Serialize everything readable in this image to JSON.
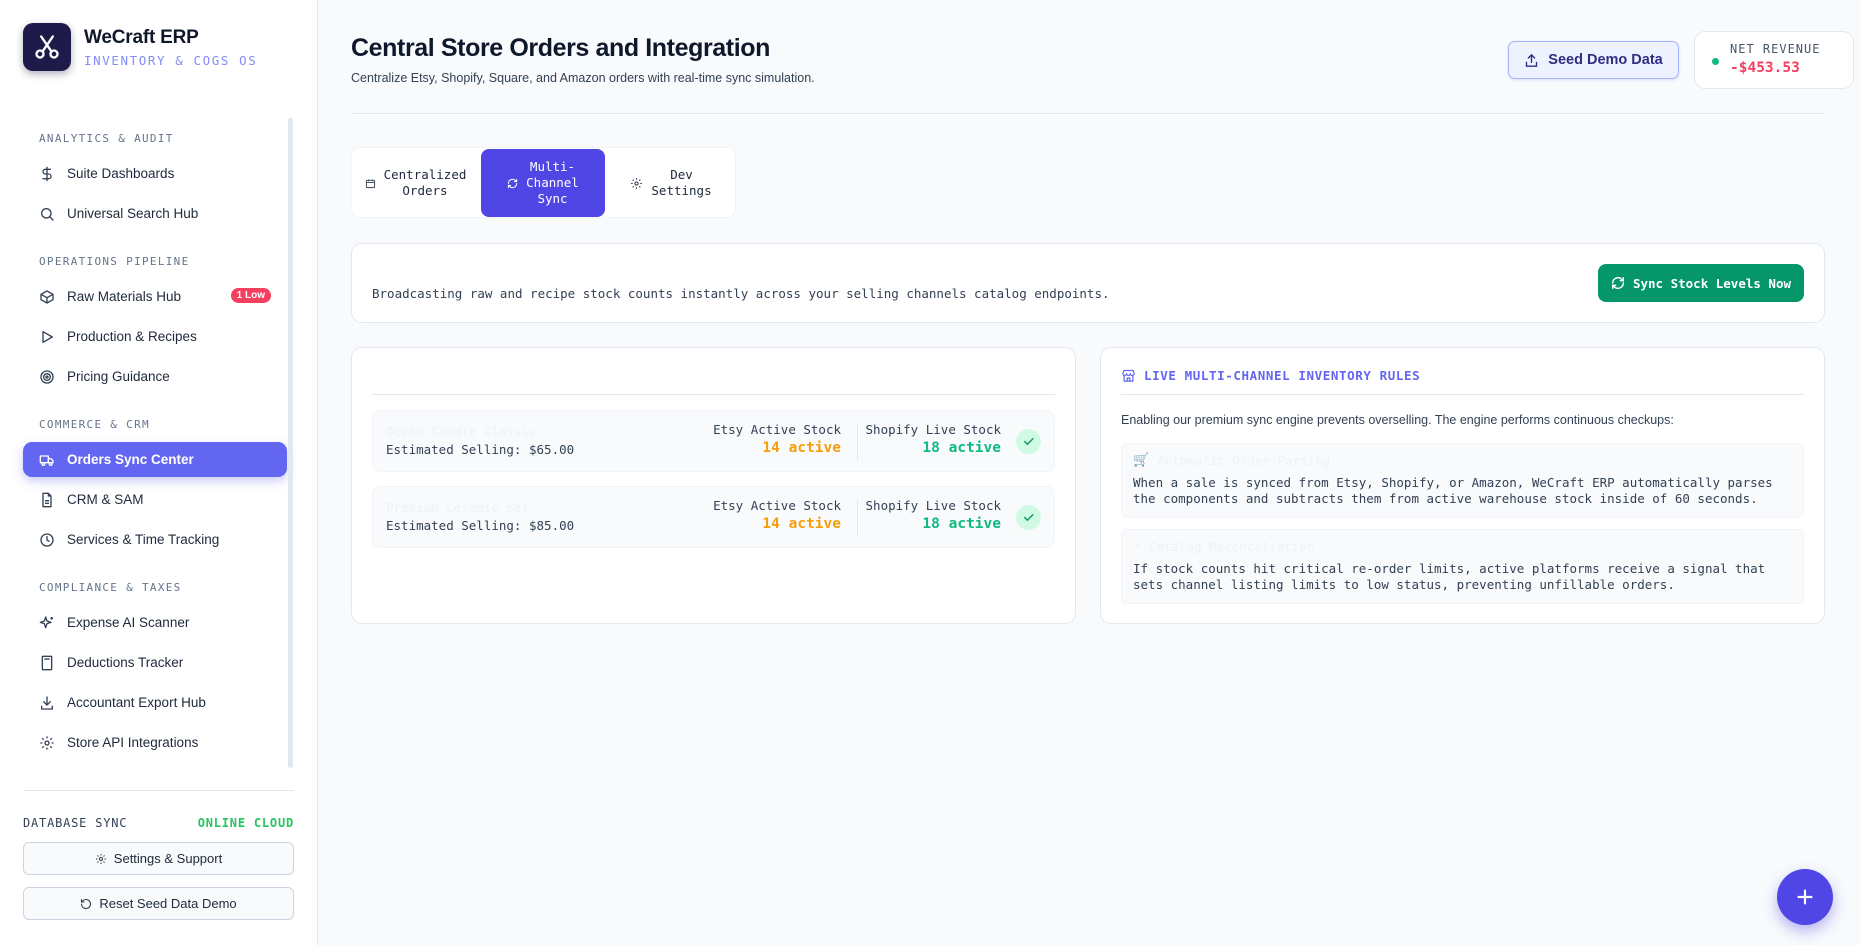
{
  "brand": {
    "name": "WeCraft ERP",
    "subtitle": "INVENTORY & COGS OS"
  },
  "sidebar": {
    "sections": [
      {
        "title": "ANALYTICS & AUDIT",
        "items": [
          {
            "label": "Suite Dashboards",
            "icon": "dollar-icon"
          },
          {
            "label": "Universal Search Hub",
            "icon": "search-icon"
          }
        ]
      },
      {
        "title": "OPERATIONS PIPELINE",
        "items": [
          {
            "label": "Raw Materials Hub",
            "icon": "box-icon",
            "badge": "1 Low"
          },
          {
            "label": "Production & Recipes",
            "icon": "play-icon"
          },
          {
            "label": "Pricing Guidance",
            "icon": "target-icon"
          }
        ]
      },
      {
        "title": "COMMERCE & CRM",
        "items": [
          {
            "label": "Orders Sync Center",
            "icon": "truck-icon",
            "active": true
          },
          {
            "label": "CRM & SAM",
            "icon": "document-icon"
          },
          {
            "label": "Services & Time Tracking",
            "icon": "clock-icon"
          }
        ]
      },
      {
        "title": "COMPLIANCE & TAXES",
        "items": [
          {
            "label": "Expense AI Scanner",
            "icon": "sparkles-icon"
          },
          {
            "label": "Deductions Tracker",
            "icon": "calculator-icon"
          },
          {
            "label": "Accountant Export Hub",
            "icon": "download-icon"
          },
          {
            "label": "Store API Integrations",
            "icon": "gear-icon"
          }
        ]
      }
    ],
    "footer": {
      "sync_label": "DATABASE SYNC",
      "sync_status": "ONLINE CLOUD",
      "settings_label": "Settings & Support",
      "reset_label": "Reset Seed Data Demo"
    }
  },
  "header": {
    "title": "Central Store Orders and Integration",
    "subtitle": "Centralize Etsy, Shopify, Square, and Amazon orders with real-time sync simulation.",
    "seed_button": "Seed Demo Data",
    "revenue_label": "NET REVENUE",
    "revenue_value": "-$453.53"
  },
  "tabs": [
    {
      "label": "Centralized\nOrders",
      "icon": "calendar-icon"
    },
    {
      "label": "Multi-\nChannel\nSync",
      "icon": "refresh-icon",
      "active": true
    },
    {
      "label": "Dev\nSettings",
      "icon": "gear-icon"
    }
  ],
  "sync_banner": {
    "text": "Broadcasting raw and recipe stock counts instantly across your selling channels catalog endpoints.",
    "button": "Sync Stock Levels Now"
  },
  "products": [
    {
      "name": "Ocean Candle Classic",
      "price": "Estimated Selling: $65.00",
      "etsy_label": "Etsy Active Stock",
      "etsy_value": "14 active",
      "shopify_label": "Shopify Live Stock",
      "shopify_value": "18 active"
    },
    {
      "name": "Premium Ceramic Set",
      "price": "Estimated Selling: $85.00",
      "etsy_label": "Etsy Active Stock",
      "etsy_value": "14 active",
      "shopify_label": "Shopify Live Stock",
      "shopify_value": "18 active"
    }
  ],
  "rules": {
    "title": "LIVE MULTI-CHANNEL INVENTORY RULES",
    "intro": "Enabling our premium sync engine prevents overselling. The engine performs continuous checkups:",
    "items": [
      {
        "emoji": "🛒",
        "title": "Automatic Order Parsing",
        "body": "When a sale is synced from Etsy, Shopify, or Amazon, WeCraft ERP automatically parses the components and subtracts them from active warehouse stock inside of 60 seconds."
      },
      {
        "emoji": "⚡",
        "title": "Catalog Reconciliation",
        "body": "If stock counts hit critical re-order limits, active platforms receive a signal that sets channel listing limits to low status, preventing unfillable orders."
      }
    ]
  },
  "colors": {
    "accent": "#6366f1",
    "primary": "#4f46e5",
    "success": "#059669",
    "danger": "#f43f5e",
    "warning": "#f59e0b"
  }
}
